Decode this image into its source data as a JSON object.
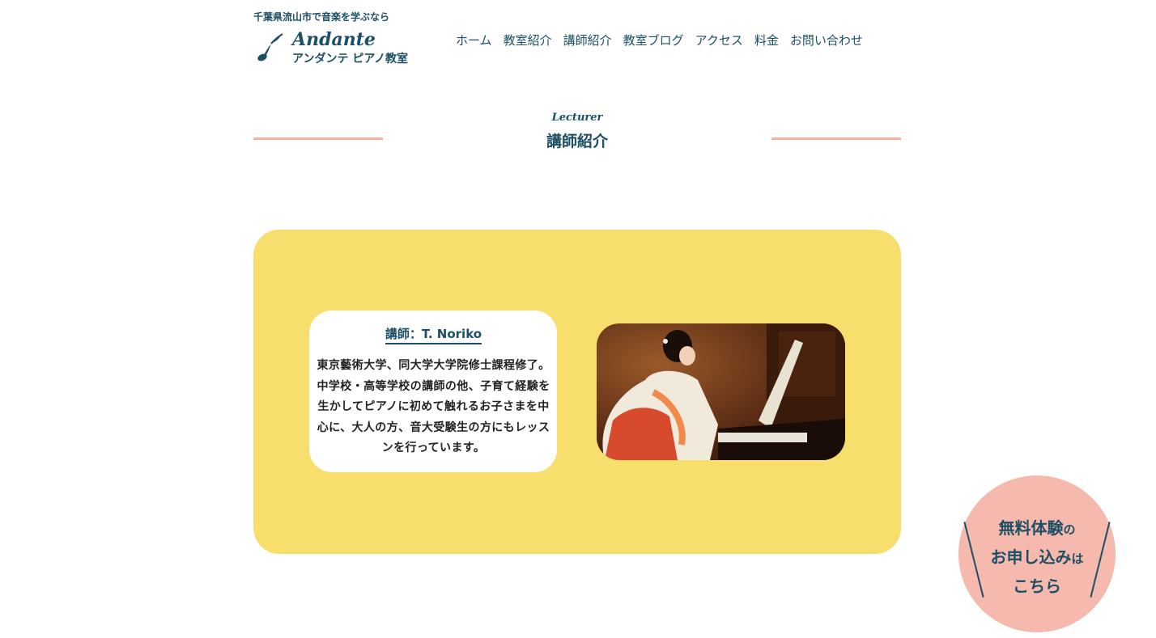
{
  "site": {
    "tagline": "千葉県流山市で音楽を学ぶなら",
    "logo_name": "Andante",
    "logo_sub": "アンダンテ ピアノ教室"
  },
  "nav": {
    "items": [
      {
        "label": "ホーム"
      },
      {
        "label": "教室紹介"
      },
      {
        "label": "講師紹介"
      },
      {
        "label": "教室ブログ"
      },
      {
        "label": "アクセス"
      },
      {
        "label": "料金"
      },
      {
        "label": "お問い合わせ"
      }
    ]
  },
  "section": {
    "title_en": "Lecturer",
    "title_jp": "講師紹介"
  },
  "lecturer": {
    "name": "講師：T. Noriko",
    "bio": "東京藝術大学、同大学大学院修士課程修了。中学校・高等学校の講師の他、子育て経験を生かしてピアノに初めて触れるお子さまを中心に、大人の方、音大受験生の方にもレッスンを行っています。"
  },
  "cta": {
    "line1_main": "無料体験",
    "line1_suffix": "の",
    "line2_main": "お申し込み",
    "line2_suffix": "は",
    "line3": "こちら"
  },
  "colors": {
    "brand": "#1c4f63",
    "panel_yellow": "#f8df6d",
    "accent_pink": "#f5b9ad"
  },
  "icons": {
    "logo": "music-note-icon"
  }
}
